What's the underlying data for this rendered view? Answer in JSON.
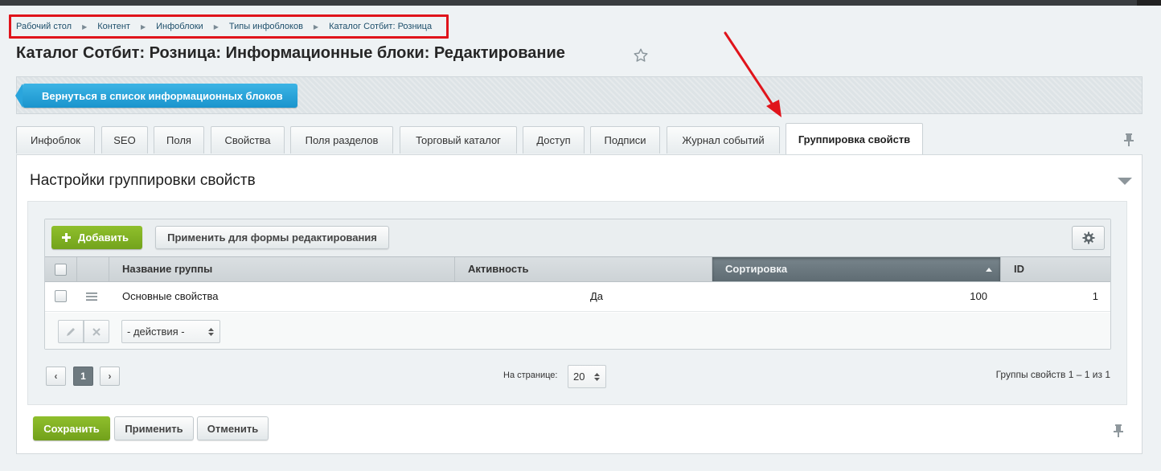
{
  "breadcrumb": [
    "Рабочий стол",
    "Контент",
    "Инфоблоки",
    "Типы инфоблоков",
    "Каталог Сотбит: Розница"
  ],
  "page_title": "Каталог Сотбит: Розница: Информационные блоки: Редактирование",
  "toolbar": {
    "back_label": "Вернуться в список информационных блоков"
  },
  "tabs": [
    {
      "label": "Инфоблок",
      "active": false
    },
    {
      "label": "SEO",
      "active": false
    },
    {
      "label": "Поля",
      "active": false
    },
    {
      "label": "Свойства",
      "active": false
    },
    {
      "label": "Поля разделов",
      "active": false
    },
    {
      "label": "Торговый каталог",
      "active": false
    },
    {
      "label": "Доступ",
      "active": false
    },
    {
      "label": "Подписи",
      "active": false
    },
    {
      "label": "Журнал событий",
      "active": false
    },
    {
      "label": "Группировка свойств",
      "active": true
    }
  ],
  "panel": {
    "title": "Настройки группировки свойств"
  },
  "grid": {
    "add_label": "Добавить",
    "apply_form_label": "Применить для формы редактирования",
    "columns": [
      "Название группы",
      "Активность",
      "Сортировка",
      "ID"
    ],
    "sorted_column": "Сортировка",
    "rows": [
      {
        "name": "Основные свойства",
        "active": "Да",
        "sort": "100",
        "id": "1"
      }
    ],
    "actions_select": "- действия -"
  },
  "pager": {
    "prev": "‹",
    "current": "1",
    "next": "›",
    "per_page_label": "На странице:",
    "per_page_value": "20",
    "summary": "Группы свойств 1 – 1 из 1"
  },
  "footer": {
    "save_label": "Сохранить",
    "apply_label": "Применить",
    "cancel_label": "Отменить"
  },
  "icons": {
    "breadcrumb_separator": "triangle-right-icon",
    "favorite": "star-outline-icon",
    "pin": "pin-icon",
    "settings": "gear-icon",
    "row_menu": "hamburger-icon",
    "edit": "pencil-icon",
    "delete": "close-icon"
  },
  "colors": {
    "accent_blue": "#1a94cd",
    "accent_green": "#7fae22",
    "annotation_red": "#e0141b"
  }
}
